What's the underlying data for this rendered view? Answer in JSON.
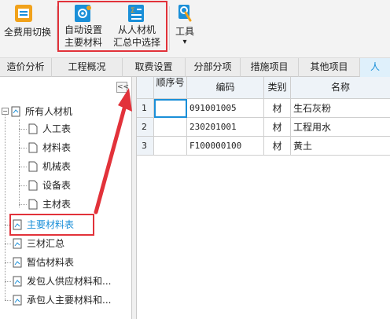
{
  "ribbon": {
    "buttons": [
      {
        "id": "full-use-switch",
        "label_lines": [
          "全费用切换"
        ]
      },
      {
        "id": "auto-set-main-material",
        "label_lines": [
          "自动设置",
          "主要材料"
        ]
      },
      {
        "id": "select-from-summary",
        "label_lines": [
          "从人材机",
          "汇总中选择"
        ]
      },
      {
        "id": "tools",
        "label_lines": [
          "工具"
        ],
        "dropdown": "▾"
      }
    ],
    "highlight_color": "#e2323a"
  },
  "tabs": [
    {
      "label": "造价分析",
      "active": false
    },
    {
      "label": "工程概况",
      "active": false
    },
    {
      "label": "取费设置",
      "active": false
    },
    {
      "label": "分部分项",
      "active": false
    },
    {
      "label": "措施项目",
      "active": false
    },
    {
      "label": "其他项目",
      "active": false
    },
    {
      "label": "人",
      "active": true
    }
  ],
  "sidebar": {
    "collapse_label": "<<",
    "root": {
      "label": "所有人材机",
      "toggle": "−"
    },
    "children": [
      {
        "label": "人工表"
      },
      {
        "label": "材料表"
      },
      {
        "label": "机械表"
      },
      {
        "label": "设备表"
      },
      {
        "label": "主材表"
      }
    ],
    "top_items": [
      {
        "label": "主要材料表",
        "selected": true
      },
      {
        "label": "三材汇总",
        "selected": false
      },
      {
        "label": "暂估材料表",
        "selected": false
      },
      {
        "label": "发包人供应材料和...",
        "selected": false
      },
      {
        "label": "承包人主要材料和...",
        "selected": false
      }
    ],
    "selected_color": "#1a8fd8"
  },
  "table": {
    "headers": [
      "",
      "顺序号",
      "编码",
      "类别",
      "名称"
    ],
    "rows": [
      {
        "num": "1",
        "seq": "",
        "code": "091001005",
        "category": "材",
        "name": "生石灰粉"
      },
      {
        "num": "2",
        "seq": "",
        "code": "230201001",
        "category": "材",
        "name": "工程用水"
      },
      {
        "num": "3",
        "seq": "",
        "code": "F100000100",
        "category": "材",
        "name": "黄土"
      }
    ]
  }
}
